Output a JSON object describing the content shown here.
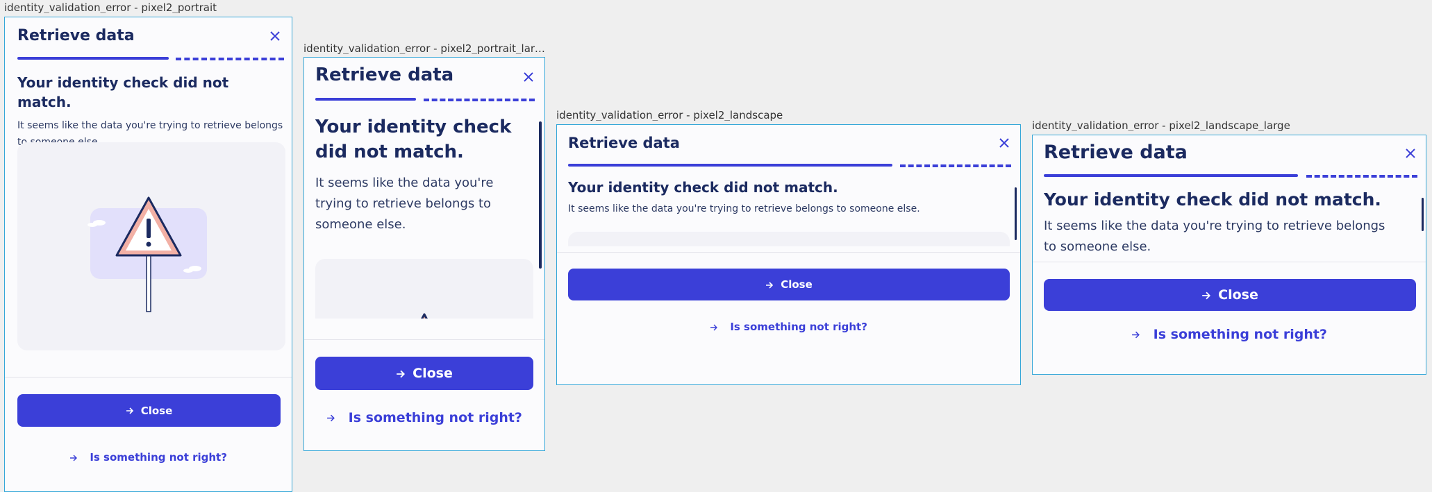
{
  "frames": [
    {
      "label": "identity_validation_error - pixel2_portrait"
    },
    {
      "label": "identity_validation_error - pixel2_portrait_large"
    },
    {
      "label": "identity_validation_error - pixel2_landscape"
    },
    {
      "label": "identity_validation_error - pixel2_landscape_large"
    }
  ],
  "dialog": {
    "title": "Retrieve data",
    "heading": "Your identity check did not match.",
    "body": "It seems like the data you're trying to retrieve belongs to someone else.",
    "close_button": "Close",
    "help_link": "Is something not right?"
  },
  "icons": {
    "close": "close-x-icon",
    "arrow": "arrow-right-icon",
    "illustration": "warning-sign-illustration"
  },
  "colors": {
    "accent": "#3b3fd8",
    "title": "#1b2a60",
    "frame_border": "#35a7d8",
    "warning_fill": "#f2b0a5"
  }
}
